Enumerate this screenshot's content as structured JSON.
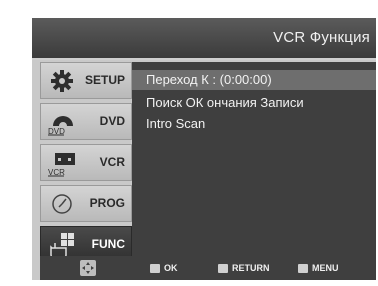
{
  "header": {
    "title": "VCR Функция"
  },
  "sidebar": {
    "items": [
      {
        "label": "SETUP",
        "icon": "gear-icon"
      },
      {
        "label": "DVD",
        "icon": "dvd-icon",
        "icon_text": "DVD"
      },
      {
        "label": "VCR",
        "icon": "vcr-icon",
        "icon_text": "VCR"
      },
      {
        "label": "PROG",
        "icon": "timer-icon"
      },
      {
        "label": "FUNC",
        "icon": "hand-icon",
        "active": true
      }
    ]
  },
  "menu": {
    "items": [
      {
        "label": "Переход К : (0:00:00)",
        "selected": true
      },
      {
        "label": "Поиск ОК ончания Записи"
      },
      {
        "label": "Intro Scan"
      }
    ]
  },
  "footer": {
    "nav_icon": "directional-pad-icon",
    "hints": [
      {
        "label": "OK",
        "icon": "enter-icon"
      },
      {
        "label": "RETURN",
        "icon": "return-icon"
      },
      {
        "label": "MENU",
        "icon": "menu-icon"
      }
    ]
  },
  "colors": {
    "active_bg": "#3a3a3a",
    "selected_row": "#6e6e6e",
    "panel": "#3f3f3f"
  }
}
